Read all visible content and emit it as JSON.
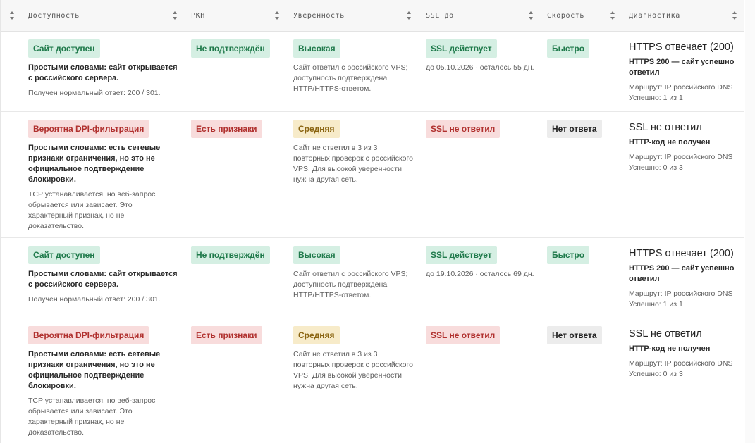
{
  "header": {
    "columns": [
      "Доступность",
      "РКН",
      "Уверенность",
      "SSL до",
      "Скорость",
      "Диагностика"
    ]
  },
  "colors": {
    "green_bg": "#d5efe3",
    "green_fg": "#1f7a4b",
    "red_bg": "#f8dcdc",
    "red_fg": "#b0302e",
    "yellow_bg": "#f7ebc9",
    "yellow_fg": "#8a6410",
    "gray_bg": "#ececec"
  },
  "rows": [
    {
      "availability": {
        "badge": "Сайт доступен",
        "summary": "Простыми словами: сайт открывается с российского сервера.",
        "detail": "Получен нормальный ответ: 200 / 301."
      },
      "rkn": "Не подтверждён",
      "confidence": {
        "badge": "Высокая",
        "detail": "Сайт ответил с российского VPS; доступность подтверждена HTTP/HTTPS-ответом."
      },
      "ssl": {
        "badge": "SSL действует",
        "detail": "до 05.10.2026 · осталось 55 дн."
      },
      "speed": "Быстро",
      "diagnostics": {
        "title": "HTTPS отвечает (200)",
        "summary": "HTTPS 200 — сайт успешно ответил",
        "route": "Маршрут: IP российского DNS",
        "success": "Успешно: 1 из 1"
      }
    },
    {
      "availability": {
        "badge": "Вероятна DPI-фильтрация",
        "summary": "Простыми словами: есть сетевые признаки ограничения, но это не официальное подтверждение блокировки.",
        "detail": "TCP устанавливается, но веб-запрос обрывается или зависает. Это характерный признак, но не доказательство."
      },
      "rkn": "Есть признаки",
      "confidence": {
        "badge": "Средняя",
        "detail": "Сайт не ответил в 3 из 3 повторных проверок с российского VPS. Для высокой уверенности нужна другая сеть."
      },
      "ssl": {
        "badge": "SSL не ответил",
        "detail": ""
      },
      "speed": "Нет ответа",
      "diagnostics": {
        "title": "SSL не ответил",
        "summary": "HTTP-код не получен",
        "route": "Маршрут: IP российского DNS",
        "success": "Успешно: 0 из 3"
      }
    },
    {
      "availability": {
        "badge": "Сайт доступен",
        "summary": "Простыми словами: сайт открывается с российского сервера.",
        "detail": "Получен нормальный ответ: 200 / 301."
      },
      "rkn": "Не подтверждён",
      "confidence": {
        "badge": "Высокая",
        "detail": "Сайт ответил с российского VPS; доступность подтверждена HTTP/HTTPS-ответом."
      },
      "ssl": {
        "badge": "SSL действует",
        "detail": "до 19.10.2026 · осталось 69 дн."
      },
      "speed": "Быстро",
      "diagnostics": {
        "title": "HTTPS отвечает (200)",
        "summary": "HTTPS 200 — сайт успешно ответил",
        "route": "Маршрут: IP российского DNS",
        "success": "Успешно: 1 из 1"
      }
    },
    {
      "availability": {
        "badge": "Вероятна DPI-фильтрация",
        "summary": "Простыми словами: есть сетевые признаки ограничения, но это не официальное подтверждение блокировки.",
        "detail": "TCP устанавливается, но веб-запрос обрывается или зависает. Это характерный признак, но не доказательство."
      },
      "rkn": "Есть признаки",
      "confidence": {
        "badge": "Средняя",
        "detail": "Сайт не ответил в 3 из 3 повторных проверок с российского VPS. Для высокой уверенности нужна другая сеть."
      },
      "ssl": {
        "badge": "SSL не ответил",
        "detail": ""
      },
      "speed": "Нет ответа",
      "diagnostics": {
        "title": "SSL не ответил",
        "summary": "HTTP-код не получен",
        "route": "Маршрут: IP российского DNS",
        "success": "Успешно: 0 из 3"
      }
    }
  ]
}
